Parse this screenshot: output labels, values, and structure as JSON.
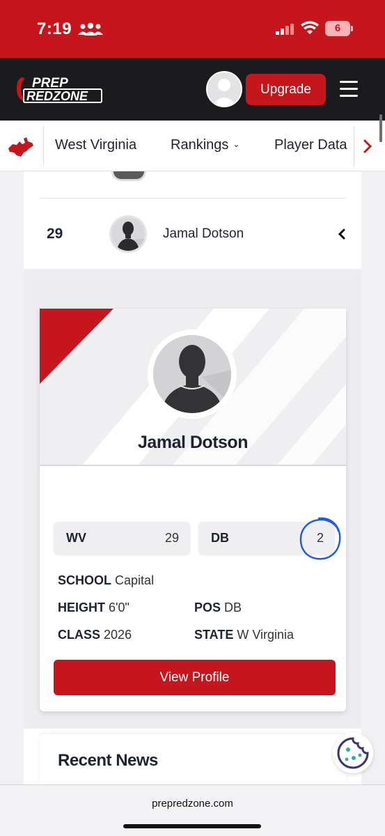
{
  "status_bar": {
    "time": "7:19",
    "battery": "6",
    "icons": [
      "people-icon",
      "signal-icon",
      "wifi-icon",
      "battery-icon"
    ]
  },
  "header": {
    "logo_line1": "PREP",
    "logo_line2": "REDZONE",
    "upgrade_label": "Upgrade",
    "icons": [
      "avatar-icon",
      "menu-icon"
    ],
    "brand_color": "#c4161c"
  },
  "nav": {
    "state": "West Virginia",
    "rankings": "Rankings",
    "player_data": "Player Data",
    "icons": [
      "west-virginia-map-icon",
      "chevron-down-icon",
      "chevron-right-icon"
    ]
  },
  "ranking_row": {
    "rank": "29",
    "name": "Jamal Dotson"
  },
  "player_card": {
    "name": "Jamal Dotson",
    "stats": [
      {
        "label": "WV",
        "value": "29"
      },
      {
        "label": "DB",
        "value": "2"
      }
    ],
    "info": {
      "school_label": "SCHOOL",
      "school": "Capital",
      "height_label": "HEIGHT",
      "height": "6'0\"",
      "pos_label": "POS",
      "pos": "DB",
      "class_label": "CLASS",
      "class": "2026",
      "state_label": "STATE",
      "state": "W Virginia"
    },
    "view_profile_label": "View Profile"
  },
  "news": {
    "title": "Recent News"
  },
  "browser": {
    "url": "prepredzone.com"
  }
}
